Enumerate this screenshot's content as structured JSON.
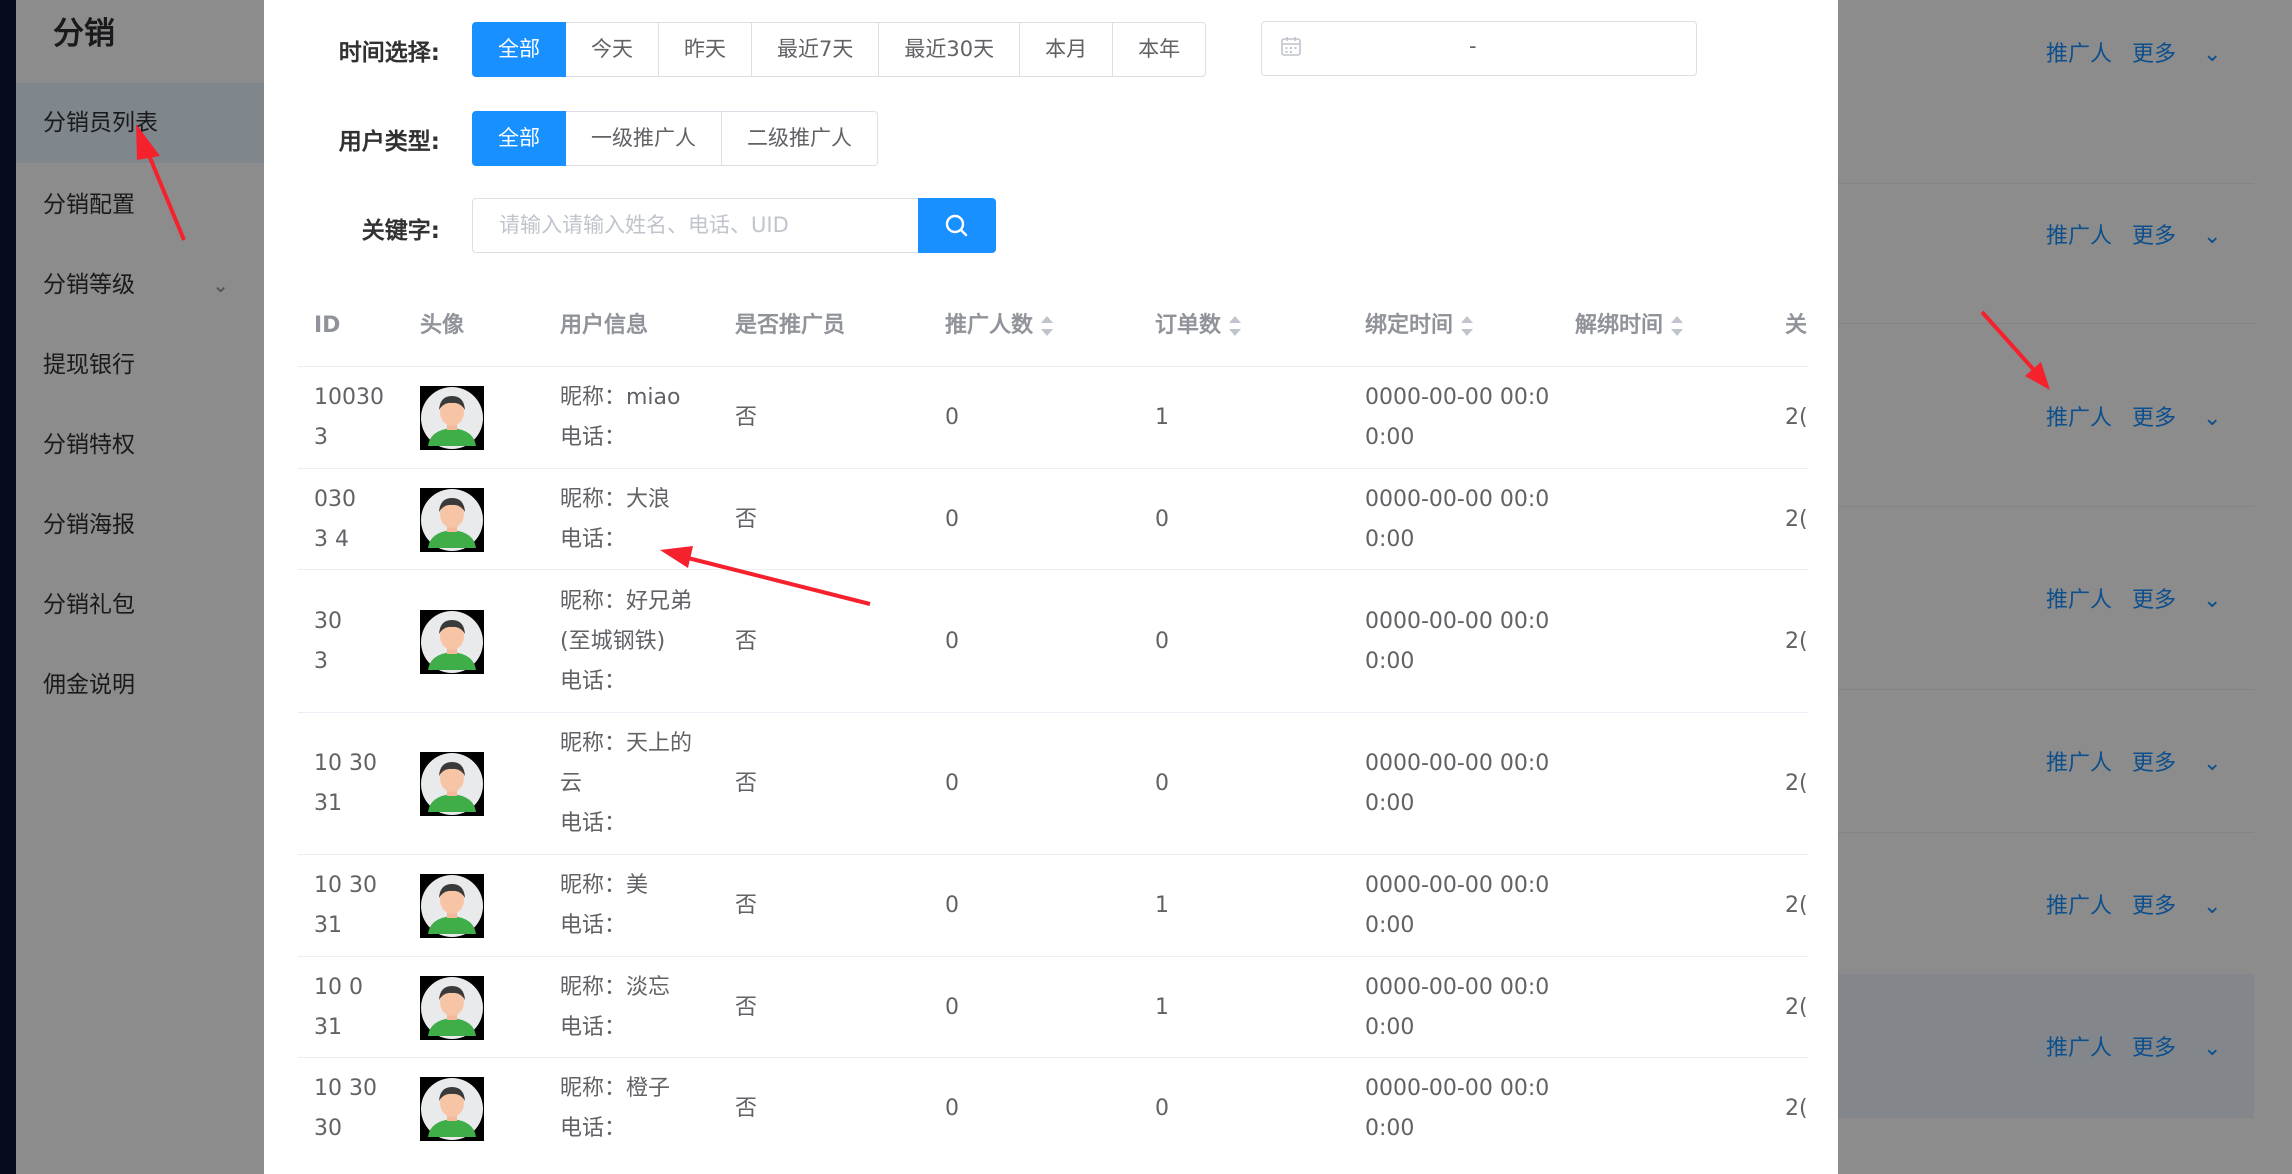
{
  "sidebar": {
    "title": "分销",
    "items": [
      {
        "label": "分销员列表"
      },
      {
        "label": "分销配置"
      },
      {
        "label": "分销等级"
      },
      {
        "label": "提现银行"
      },
      {
        "label": "分销特权"
      },
      {
        "label": "分销海报"
      },
      {
        "label": "分销礼包"
      },
      {
        "label": "佣金说明"
      }
    ]
  },
  "background_actions": {
    "promoter_link": "推广人",
    "more_link": "更多"
  },
  "filters": {
    "time_label": "时间选择:",
    "time_options": [
      "全部",
      "今天",
      "昨天",
      "最近7天",
      "最近30天",
      "本月",
      "本年"
    ],
    "date_range_separator": "-",
    "user_type_label": "用户类型:",
    "user_type_options": [
      "全部",
      "一级推广人",
      "二级推广人"
    ],
    "keyword_label": "关键字:",
    "keyword_placeholder": "请输入请输入姓名、电话、UID"
  },
  "table": {
    "headers": [
      "ID",
      "头像",
      "用户信息",
      "是否推广员",
      "推广人数",
      "订单数",
      "绑定时间",
      "解绑时间",
      "关"
    ],
    "rows": [
      {
        "id_top": "10030",
        "id_bot": "3",
        "nick_lines": [
          "昵称：miao"
        ],
        "phone": "电话：",
        "is_promoter": "否",
        "promoted": "0",
        "orders": "1",
        "bind_time_1": "0000-00-00 00:0",
        "bind_time_2": "0:00",
        "last": "2("
      },
      {
        "id_top": "030",
        "id_bot": "3 4",
        "nick_lines": [
          "昵称：大浪"
        ],
        "phone": "电话：",
        "is_promoter": "否",
        "promoted": "0",
        "orders": "0",
        "bind_time_1": "0000-00-00 00:0",
        "bind_time_2": "0:00",
        "last": "2("
      },
      {
        "id_top": "30",
        "id_bot": "3",
        "nick_lines": [
          "昵称：好兄弟",
          "(至城钢铁)"
        ],
        "phone": "电话：",
        "is_promoter": "否",
        "promoted": "0",
        "orders": "0",
        "bind_time_1": "0000-00-00 00:0",
        "bind_time_2": "0:00",
        "last": "2("
      },
      {
        "id_top": "10 30",
        "id_bot": "31",
        "nick_lines": [
          "昵称：天上的",
          "云"
        ],
        "phone": "电话：",
        "is_promoter": "否",
        "promoted": "0",
        "orders": "0",
        "bind_time_1": "0000-00-00 00:0",
        "bind_time_2": "0:00",
        "last": "2("
      },
      {
        "id_top": "10 30",
        "id_bot": "31",
        "nick_lines": [
          "昵称：美"
        ],
        "phone": "电话：",
        "is_promoter": "否",
        "promoted": "0",
        "orders": "1",
        "bind_time_1": "0000-00-00 00:0",
        "bind_time_2": "0:00",
        "last": "2("
      },
      {
        "id_top": "10 0",
        "id_bot": "31",
        "nick_lines": [
          "昵称：淡忘"
        ],
        "phone": "电话：",
        "is_promoter": "否",
        "promoted": "0",
        "orders": "1",
        "bind_time_1": "0000-00-00 00:0",
        "bind_time_2": "0:00",
        "last": "2("
      },
      {
        "id_top": "10 30",
        "id_bot": "30",
        "nick_lines": [
          "昵称：橙子"
        ],
        "phone": "电话：",
        "is_promoter": "否",
        "promoted": "0",
        "orders": "0",
        "bind_time_1": "0000-00-00 00:0",
        "bind_time_2": "0:00",
        "last": "2("
      }
    ]
  },
  "colors": {
    "primary": "#1890ff",
    "annotation_arrow": "#f5222d"
  }
}
